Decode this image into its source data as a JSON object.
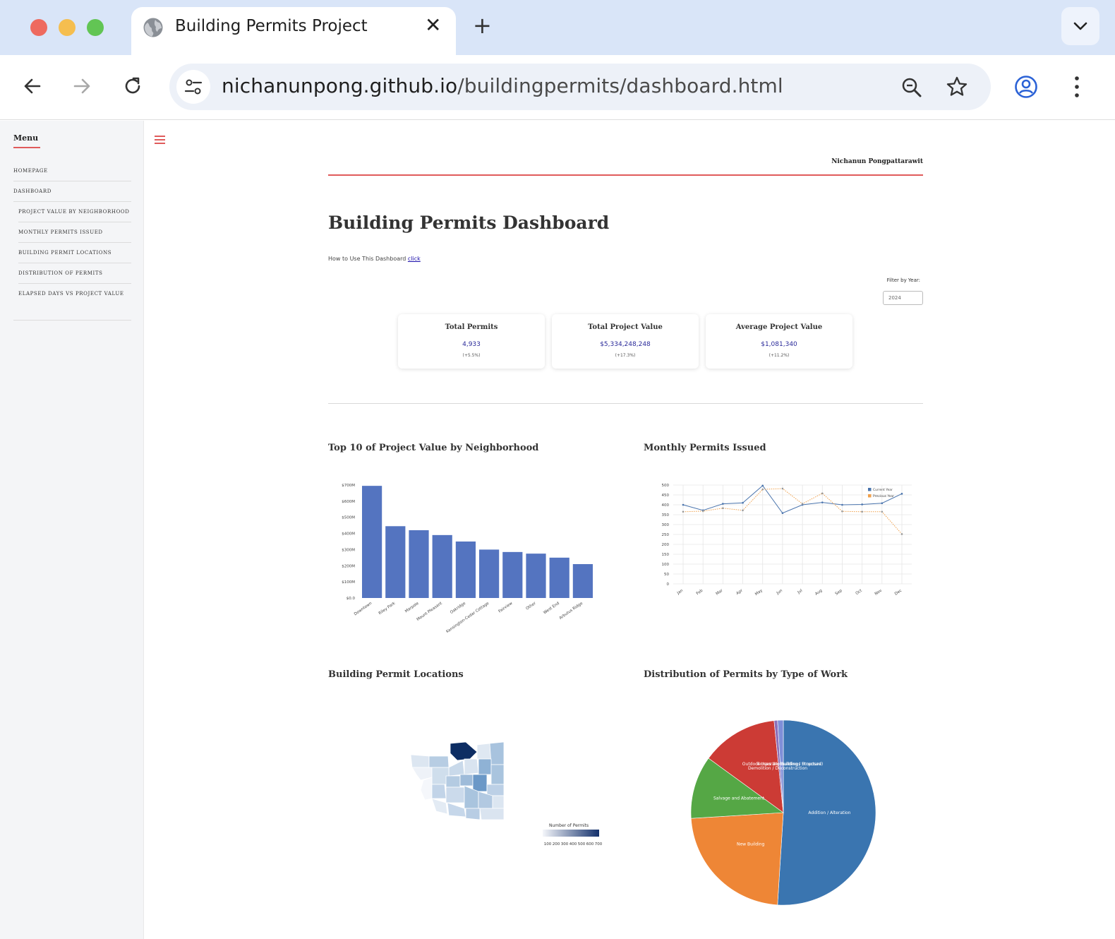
{
  "browser": {
    "tab_title": "Building Permits Project",
    "url_host": "nichanunpong.github.io",
    "url_path": "/buildingpermits/dashboard.html",
    "colors": {
      "close": "#ee6a5f",
      "minimize": "#f5be4f",
      "maximize": "#62c554",
      "tabstrip": "#d9e5f8"
    }
  },
  "sidebar": {
    "title": "Menu",
    "items": [
      {
        "label": "Homepage"
      },
      {
        "label": "Dashboard"
      },
      {
        "label": "Project Value by Neighborhood"
      },
      {
        "label": "Monthly Permits Issued"
      },
      {
        "label": "Building Permit Locations"
      },
      {
        "label": "Distribution of Permits"
      },
      {
        "label": "Elapsed Days vs Project Value"
      }
    ]
  },
  "header": {
    "author": "Nichanun Pongpattarawit",
    "title": "Building Permits Dashboard",
    "howto_text": "How to Use This Dashboard",
    "howto_link": "click",
    "filter_label": "Filter by Year:",
    "filter_value": "2024"
  },
  "kpis": [
    {
      "title": "Total Permits",
      "value": "4,933",
      "change": "(+5.5%)"
    },
    {
      "title": "Total Project Value",
      "value": "$5,334,248,248",
      "change": "(+17.3%)"
    },
    {
      "title": "Average Project Value",
      "value": "$1,081,340",
      "change": "(+11.2%)"
    }
  ],
  "sections": {
    "bar": "Top 10 of Project Value by Neighborhood",
    "line": "Monthly Permits Issued",
    "map": "Building Permit Locations",
    "pie": "Distribution of Permits by Type of Work"
  },
  "chart_data": [
    {
      "type": "bar",
      "categories": [
        "Downtown",
        "Riley Park",
        "Marpole",
        "Mount Pleasant",
        "Oakridge",
        "Kensington-Cedar Cottage",
        "Fairview",
        "Other",
        "West End",
        "Arbutus Ridge"
      ],
      "values": [
        695,
        445,
        420,
        390,
        350,
        300,
        285,
        275,
        250,
        210
      ],
      "ylim": [
        0,
        700
      ],
      "ytick_labels": [
        "$0.0",
        "$100M",
        "$200M",
        "$300M",
        "$400M",
        "$500M",
        "$600M",
        "$700M"
      ],
      "color": "#5474c0"
    },
    {
      "type": "line",
      "categories": [
        "Jan",
        "Feb",
        "Mar",
        "Apr",
        "May",
        "Jun",
        "Jul",
        "Aug",
        "Sep",
        "Oct",
        "Nov",
        "Dec"
      ],
      "series": [
        {
          "name": "Current Year",
          "values": [
            400,
            372,
            405,
            410,
            497,
            358,
            400,
            412,
            400,
            402,
            408,
            456
          ],
          "color": "#4a74ad"
        },
        {
          "name": "Previous Year",
          "values": [
            365,
            368,
            383,
            372,
            478,
            482,
            405,
            458,
            367,
            365,
            365,
            252
          ],
          "color": "#f0a04b"
        }
      ],
      "ylim": [
        0,
        500
      ],
      "yticks": [
        0,
        50,
        100,
        150,
        200,
        250,
        300,
        350,
        400,
        450,
        500
      ],
      "legend": "top-right",
      "grid": true
    },
    {
      "type": "heatmap",
      "legend_title": "Number of Permits",
      "legend_ticks": [
        100,
        200,
        300,
        400,
        500,
        600,
        700
      ],
      "color_low": "#f4f6fa",
      "color_high": "#13306b"
    },
    {
      "type": "pie",
      "labels": [
        "Addition / Alteration",
        "New Building",
        "Salvage and Abatement",
        "Demolition / Deconstruction",
        "Outdoor Uses (No Buildings Proposed)",
        "Temporary Building / Structure"
      ],
      "values": [
        51,
        23,
        11,
        13.4,
        0.6,
        1.0
      ],
      "colors": [
        "#3a75b0",
        "#ee8636",
        "#55a745",
        "#cc3b35",
        "#8c70b8",
        "#7f8fd8"
      ]
    }
  ]
}
